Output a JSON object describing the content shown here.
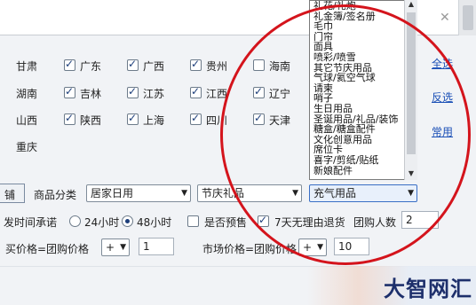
{
  "provinces": {
    "row1": {
      "left": "甘肃",
      "items": [
        {
          "label": "广东",
          "checked": true
        },
        {
          "label": "广西",
          "checked": true
        },
        {
          "label": "贵州",
          "checked": true
        },
        {
          "label": "海南",
          "checked": false
        }
      ]
    },
    "row2": {
      "left": "湖南",
      "items": [
        {
          "label": "吉林",
          "checked": true
        },
        {
          "label": "江苏",
          "checked": true
        },
        {
          "label": "江西",
          "checked": true
        },
        {
          "label": "辽宁",
          "checked": true
        }
      ]
    },
    "row3": {
      "left": "山西",
      "items": [
        {
          "label": "陕西",
          "checked": true
        },
        {
          "label": "上海",
          "checked": true
        },
        {
          "label": "四川",
          "checked": true
        },
        {
          "label": "天津",
          "checked": true
        }
      ]
    },
    "row4": {
      "left": "重庆"
    }
  },
  "links": {
    "select_all": "全选",
    "invert": "反选",
    "common": "常用"
  },
  "category_dropdown": {
    "options": [
      "礼花/礼炮",
      "礼金簿/签名册",
      "毛巾",
      "门帘",
      "面具",
      "喷彩/喷雪",
      "其它节庆用品",
      "气球/氦空气球",
      "请柬",
      "哨子",
      "生日用品",
      "圣诞用品/礼品/装饰",
      "糖盒/糖盒配件",
      "文化创意用品",
      "席位卡",
      "喜字/剪纸/贴纸",
      "新娘配件"
    ]
  },
  "category_bar": {
    "left_button": "铺",
    "label": "商品分类",
    "select1": "居家日用",
    "select2": "节庆礼品",
    "select3": "充气用品"
  },
  "delivery": {
    "label": "发时间承诺",
    "opt1": "24小时",
    "opt1_checked": false,
    "opt2": "48小时",
    "opt2_checked": true,
    "presale_label": "是否预售",
    "presale_checked": false,
    "return_label": "7天无理由退货",
    "return_checked": true,
    "group_count_label": "团购人数",
    "group_count_value": "2"
  },
  "pricing": {
    "buy_label": "买价格=团购价格",
    "buy_op": "+",
    "buy_value": "1",
    "market_label": "市场价格=团购价格",
    "market_op": "+",
    "market_value": "10"
  },
  "watermark": {
    "text": "大智网汇"
  },
  "colors": {
    "annotation_circle": "#d4141c",
    "link": "#1a4fb6"
  }
}
